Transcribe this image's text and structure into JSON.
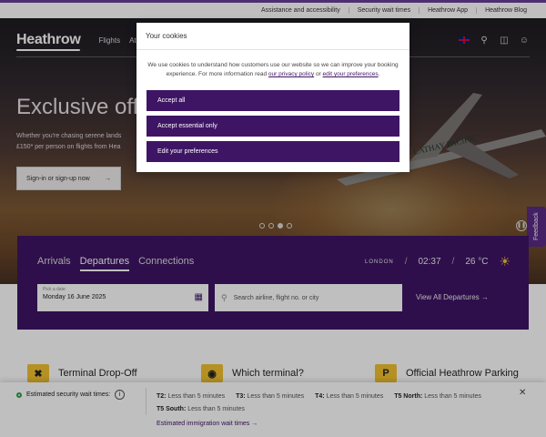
{
  "utility_links": [
    "Assistance and accessibility",
    "Security wait times",
    "Heathrow App",
    "Heathrow Blog"
  ],
  "nav": {
    "logo": "Heathrow",
    "links": [
      "Flights",
      "At"
    ],
    "icons": [
      "uk-flag-icon",
      "search-icon",
      "bag-icon",
      "user-icon"
    ]
  },
  "hero": {
    "title": "Exclusive offe",
    "description_line1": "Whether you're chasing serene lands",
    "description_line2": "£150* per person on flights from Hea",
    "signin_label": "Sign-in or sign-up now",
    "signin_arrow": "→",
    "plane_livery": "CATHAY PACIFIC",
    "slides": 4,
    "active_slide": 3
  },
  "feedback_label": "Feedback",
  "flights_panel": {
    "tabs": [
      "Arrivals",
      "Departures",
      "Connections"
    ],
    "active_tab": "Departures",
    "city": "LONDON",
    "time": "02:37",
    "temperature": "26 °C",
    "date_label": "Pick a date",
    "date_value": "Monday 16 June 2025",
    "search_placeholder": "Search airline, flight no. or city",
    "view_all": "View All Departures  →"
  },
  "promos": [
    {
      "icon": "car-dropoff-icon",
      "title": "Terminal Drop-Off"
    },
    {
      "icon": "terminal-icon",
      "title": "Which terminal?"
    },
    {
      "icon": "parking-icon",
      "glyph": "P",
      "title": "Official Heathrow Parking"
    }
  ],
  "security_banner": {
    "heading": "Estimated security wait times:",
    "info_glyph": "i",
    "times": [
      {
        "terminal": "T2:",
        "wait": "Less than 5 minutes"
      },
      {
        "terminal": "T3:",
        "wait": "Less than 5 minutes"
      },
      {
        "terminal": "T4:",
        "wait": "Less than 5 minutes"
      },
      {
        "terminal": "T5 North:",
        "wait": "Less than 5 minutes"
      },
      {
        "terminal": "T5 South:",
        "wait": "Less than 5 minutes"
      }
    ],
    "immigration_link": "Estimated immigration wait times  →",
    "close": "✕"
  },
  "cookie_modal": {
    "title": "Your cookies",
    "body_prefix": "We use cookies to understand how customers use our website so we can improve your booking experience. For more information read ",
    "privacy_link": "our privacy policy",
    "body_or": " or ",
    "preferences_link": "edit your preferences",
    "body_suffix": ".",
    "accept_all": "Accept all",
    "accept_essential": "Accept essential only",
    "edit_preferences": "Edit your preferences"
  }
}
